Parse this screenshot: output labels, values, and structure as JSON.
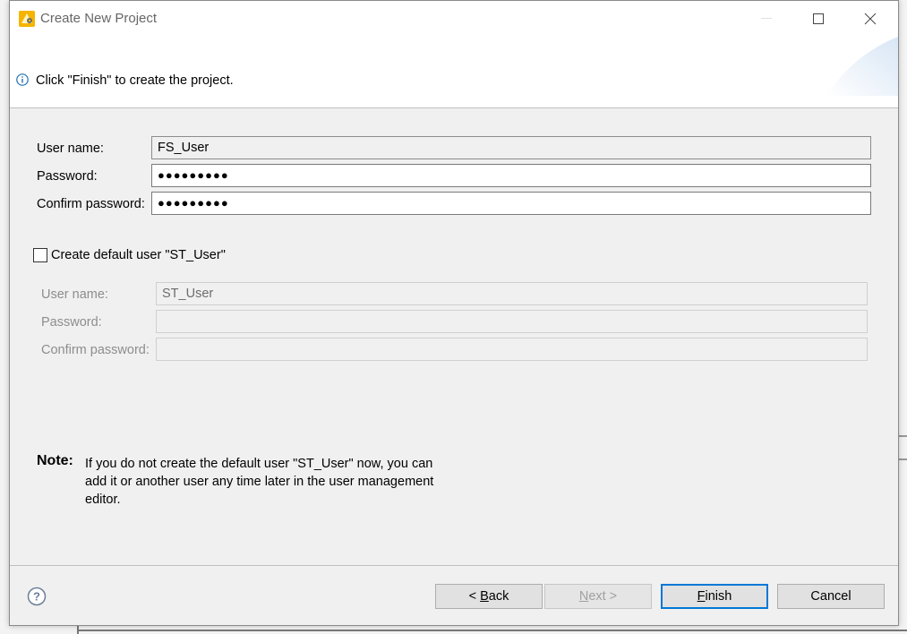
{
  "window": {
    "title": "Create New Project"
  },
  "header": {
    "message": "Click \"Finish\" to create the project."
  },
  "project_user": {
    "username_label": "User name:",
    "username_value": "FS_User",
    "password_label": "Password:",
    "password_value": "●●●●●●●●●",
    "confirm_label": "Confirm password:",
    "confirm_value": "●●●●●●●●●"
  },
  "default_user": {
    "checkbox_label": "Create default user \"ST_User\"",
    "checked": false,
    "username_label": "User name:",
    "username_value": "ST_User",
    "password_label": "Password:",
    "password_value": "",
    "confirm_label": "Confirm password:",
    "confirm_value": ""
  },
  "note": {
    "label": "Note:",
    "text": "If you do not create the default user \"ST_User\" now, you can add it or another user any time later in the user management editor."
  },
  "buttons": {
    "back_prefix": "< ",
    "back_underlined": "B",
    "back_rest": "ack",
    "next_underlined": "N",
    "next_rest": "ext >",
    "finish_underlined": "F",
    "finish_rest": "inish",
    "cancel": "Cancel"
  },
  "colors": {
    "accent": "#0078d7",
    "info_icon": "#1f6fb2"
  },
  "icons": {
    "app": "project-wizard-icon",
    "info": "info-icon",
    "help": "help-icon"
  }
}
